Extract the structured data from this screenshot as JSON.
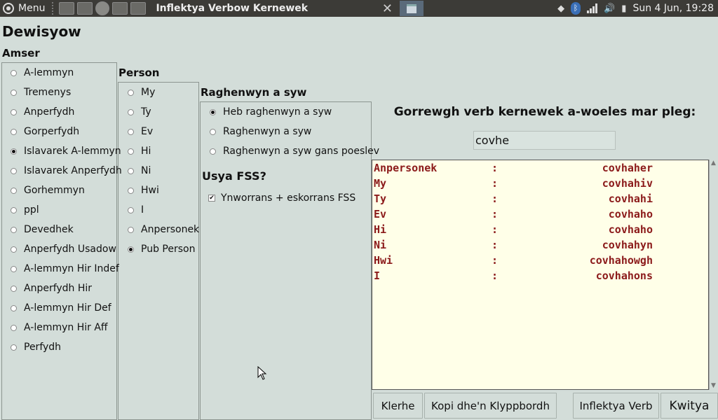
{
  "panel": {
    "menu_label": "Menu",
    "window_title": "Inflektya Verbow Kernewek",
    "close_glyph": "✕",
    "clock": "Sun  4 Jun, 19:28"
  },
  "main": {
    "title": "Dewisyow",
    "tense": {
      "heading": "Amser",
      "options": [
        "A-lemmyn",
        "Tremenys",
        "Anperfydh",
        "Gorperfydh",
        "Islavarek A-lemmyn",
        "Islavarek Anperfydh",
        "Gorhemmyn",
        "ppl",
        "Devedhek",
        "Anperfydh Usadow",
        "A-lemmyn Hir Indef",
        "Anperfydh Hir",
        "A-lemmyn Hir Def",
        "A-lemmyn Hir Aff",
        "Perfydh"
      ],
      "selected": "Islavarek A-lemmyn"
    },
    "person": {
      "heading": "Person",
      "options": [
        "My",
        "Ty",
        "Ev",
        "Hi",
        "Ni",
        "Hwi",
        "I",
        "Anpersonek",
        "Pub Person"
      ],
      "selected": "Pub Person"
    },
    "pronoun": {
      "heading": "Raghenwyn a syw",
      "options": [
        "Heb raghenwyn a syw",
        "Raghenwyn a syw",
        "Raghenwyn a syw gans poeslev"
      ],
      "selected": "Heb raghenwyn a syw"
    },
    "fss": {
      "heading": "Usya FSS?",
      "checkbox_label": "Ynworrans + eskorrans FSS",
      "checked": true
    },
    "prompt": "Gorrewgh verb kernewek a-woeles mar pleg:",
    "verb_input": "covhe",
    "output": [
      {
        "person": "Anpersonek",
        "sep": ":",
        "form": "covhaher"
      },
      {
        "person": "My",
        "sep": ":",
        "form": "covhahiv"
      },
      {
        "person": "Ty",
        "sep": ":",
        "form": "covhahi"
      },
      {
        "person": "Ev",
        "sep": ":",
        "form": "covhaho"
      },
      {
        "person": "Hi",
        "sep": ":",
        "form": "covhaho"
      },
      {
        "person": "Ni",
        "sep": ":",
        "form": "covhahyn"
      },
      {
        "person": "Hwi",
        "sep": ":",
        "form": "covhahowgh"
      },
      {
        "person": "I",
        "sep": ":",
        "form": "covhahons"
      }
    ]
  },
  "buttons": {
    "clear": "Klerhe",
    "copy": "Kopi dhe'n Klyppbordh",
    "inflect": "Inflektya Verb",
    "quit": "Kwitya"
  }
}
